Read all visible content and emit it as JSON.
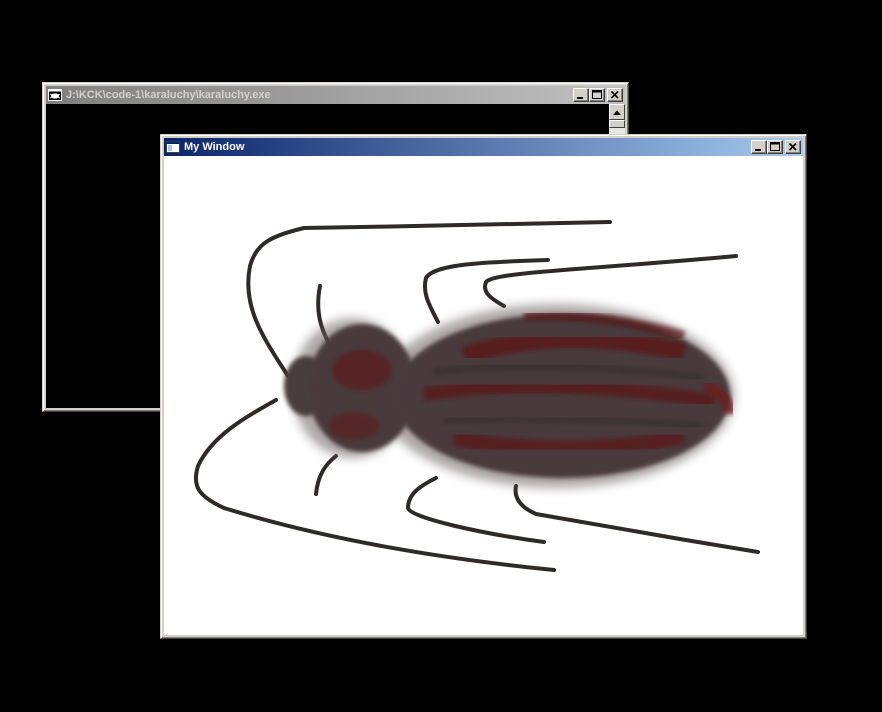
{
  "console_window": {
    "title": "J:\\KCK\\code-1\\karaluchy\\karaluchy.exe",
    "icon": "console-icon"
  },
  "my_window": {
    "title": "My Window",
    "icon": "application-icon",
    "canvas_content": "cockroach-drawing"
  },
  "caption_buttons": {
    "minimize": "minimize-icon",
    "maximize": "maximize-icon",
    "close": "close-icon"
  },
  "colors": {
    "desktop": "#000000",
    "active_title_start": "#0a246a",
    "active_title_end": "#a6caf0",
    "inactive_title_start": "#808080",
    "inactive_title_end": "#c0c0c0",
    "body": "#4a3b3c",
    "body_tint": "#5c1818",
    "legs": "#2e2a28"
  }
}
